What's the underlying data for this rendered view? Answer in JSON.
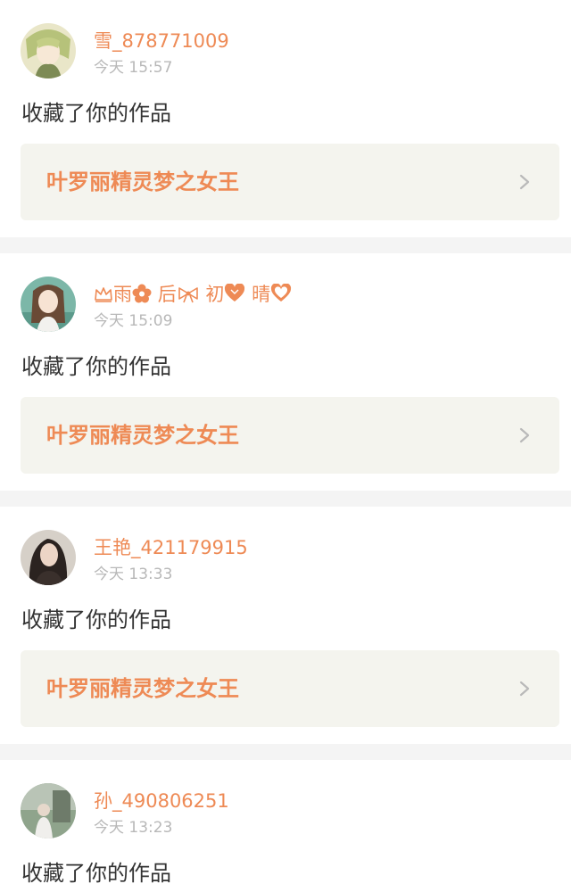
{
  "colors": {
    "accent": "#ee8a55",
    "timestamp": "#b8b8b8",
    "text": "#333333",
    "card_bg": "#ffffff",
    "work_bg": "#f4f4ee",
    "page_bg": "#f4f4f4"
  },
  "notifications": [
    {
      "username": "雪_878771009",
      "time": "今天 15:57",
      "action": "收藏了你的作品",
      "work_title": "叶罗丽精灵梦之女王",
      "avatar": "anime-girl-avatar"
    },
    {
      "username_parts": [
        "雨",
        "后",
        "初",
        "晴"
      ],
      "username_icons": [
        "crown-icon",
        "flower-icon",
        "bow-icon",
        "heart-icon"
      ],
      "time": "今天 15:09",
      "action": "收藏了你的作品",
      "work_title": "叶罗丽精灵梦之女王",
      "avatar": "anime-girl-avatar"
    },
    {
      "username": "王艳_421179915",
      "time": "今天 13:33",
      "action": "收藏了你的作品",
      "work_title": "叶罗丽精灵梦之女王",
      "avatar": "photo-avatar"
    },
    {
      "username": "孙_490806251",
      "time": "今天 13:23",
      "action": "收藏了你的作品",
      "avatar": "photo-avatar"
    }
  ]
}
